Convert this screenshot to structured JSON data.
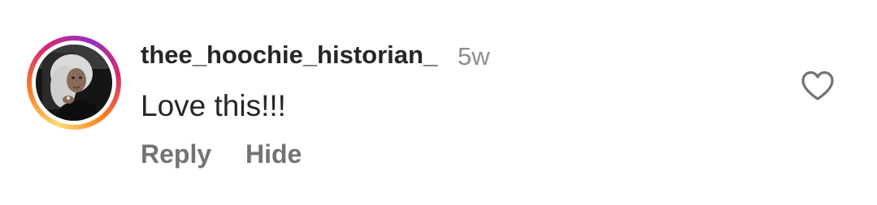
{
  "comment": {
    "username": "thee_hoochie_historian_",
    "timestamp": "5w",
    "text": "Love this!!!",
    "actions": {
      "reply": "Reply",
      "hide": "Hide"
    }
  },
  "icons": {
    "like": "heart-outline-icon"
  },
  "colors": {
    "username": "#262626",
    "secondary": "#8e8e8e",
    "action": "#737373",
    "story_ring": [
      "#feda75",
      "#fa7e1e",
      "#d62976",
      "#962fbf"
    ]
  }
}
